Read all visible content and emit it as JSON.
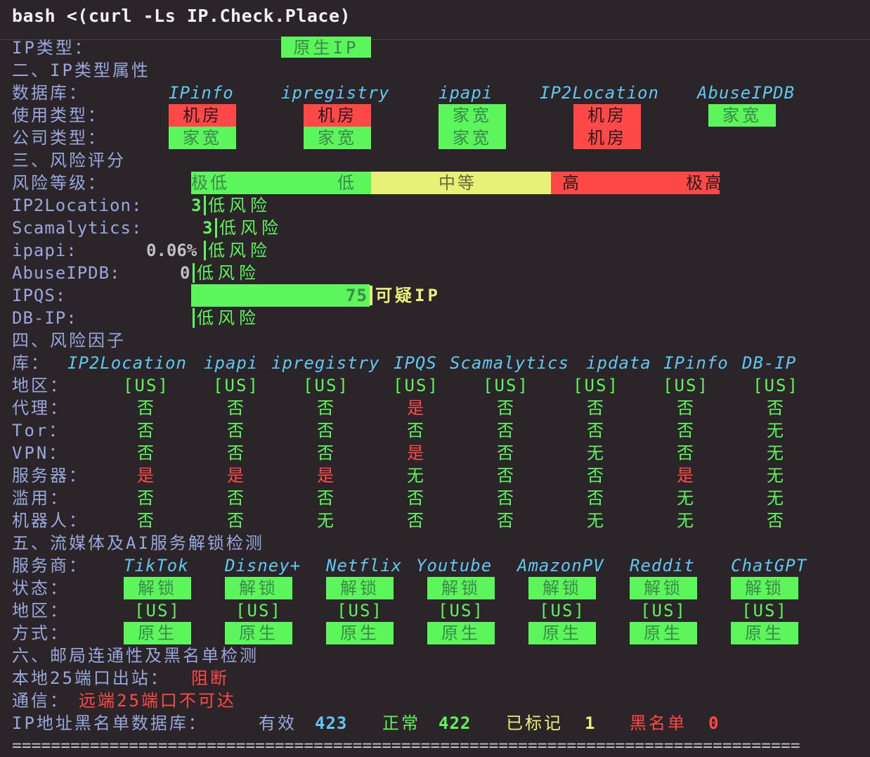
{
  "command": "bash <(curl -Ls IP.Check.Place)",
  "ip_type": {
    "label": "IP类型：",
    "value": "原生IP"
  },
  "section2": {
    "title": "二、IP类型属性",
    "db_label": "数据库：",
    "usage_label": "使用类型：",
    "company_label": "公司类型：",
    "sources": [
      "IPinfo",
      "ipregistry",
      "ipapi",
      "IP2Location",
      "AbuseIPDB"
    ],
    "usage": [
      "机房",
      "机房",
      "家宽",
      "机房",
      "家宽"
    ],
    "usage_colors": [
      "#ff4848",
      "#ff4848",
      "#5cf55c",
      "#ff4848",
      "#5cf55c"
    ],
    "company": [
      "家宽",
      "家宽",
      "家宽",
      "机房",
      ""
    ],
    "company_colors": [
      "#5cf55c",
      "#5cf55c",
      "#5cf55c",
      "#ff4848",
      ""
    ]
  },
  "section3": {
    "title": "三、风险评分",
    "level_label": "风险等级：",
    "scale": [
      "极低",
      "低",
      "中等",
      "高",
      "极高"
    ],
    "rows": [
      {
        "name": "IP2Location:",
        "score": "3",
        "result": "低风险"
      },
      {
        "name": "Scamalytics:",
        "score": "3",
        "result": "低风险"
      },
      {
        "name": "ipapi:",
        "score": "0.06%",
        "result": "低风险"
      },
      {
        "name": "AbuseIPDB:",
        "score": "0",
        "result": "低风险"
      },
      {
        "name": "IPQS:",
        "score": "75",
        "result": "可疑IP",
        "fill": 0.75
      },
      {
        "name": "DB-IP:",
        "score": "",
        "result": "低风险"
      }
    ]
  },
  "section4": {
    "title": "四、风险因子",
    "db_label": "库：",
    "sources": [
      "IP2Location",
      "ipapi",
      "ipregistry",
      "IPQS",
      "Scamalytics",
      "ipdata",
      "IPinfo",
      "DB-IP"
    ],
    "rows": [
      {
        "label": "地区：",
        "values": [
          "[US]",
          "[US]",
          "[US]",
          "[US]",
          "[US]",
          "[US]",
          "[US]",
          "[US]"
        ]
      },
      {
        "label": "代理：",
        "values": [
          "否",
          "否",
          "否",
          "是",
          "否",
          "否",
          "否",
          "否"
        ]
      },
      {
        "label": "Tor：",
        "values": [
          "否",
          "否",
          "否",
          "否",
          "否",
          "否",
          "否",
          "无"
        ]
      },
      {
        "label": "VPN：",
        "values": [
          "否",
          "否",
          "否",
          "是",
          "否",
          "无",
          "否",
          "无"
        ]
      },
      {
        "label": "服务器：",
        "values": [
          "是",
          "是",
          "是",
          "无",
          "否",
          "否",
          "是",
          "无"
        ]
      },
      {
        "label": "滥用：",
        "values": [
          "否",
          "否",
          "否",
          "否",
          "否",
          "否",
          "无",
          "无"
        ]
      },
      {
        "label": "机器人：",
        "values": [
          "否",
          "否",
          "无",
          "否",
          "否",
          "无",
          "无",
          "否"
        ]
      }
    ]
  },
  "section5": {
    "title": "五、流媒体及AI服务解锁检测",
    "provider_label": "服务商：",
    "status_label": "状态：",
    "region_label": "地区：",
    "method_label": "方式：",
    "providers": [
      "TikTok",
      "Disney+",
      "Netflix",
      "Youtube",
      "AmazonPV",
      "Reddit",
      "ChatGPT"
    ],
    "status": [
      "解锁",
      "解锁",
      "解锁",
      "解锁",
      "解锁",
      "解锁",
      "解锁"
    ],
    "region": [
      "[US]",
      "[US]",
      "[US]",
      "[US]",
      "[US]",
      "[US]",
      "[US]"
    ],
    "method": [
      "原生",
      "原生",
      "原生",
      "原生",
      "原生",
      "原生",
      "原生"
    ]
  },
  "section6": {
    "title": "六、邮局连通性及黑名单检测",
    "port25_label": "本地25端口出站：",
    "port25_value": "阻断",
    "comm_label": "通信：",
    "comm_value": "远端25端口不可达",
    "bl_label": "IP地址黑名单数据库：",
    "valid_label": "有效",
    "valid_value": "423",
    "normal_label": "正常",
    "normal_value": "422",
    "marked_label": "已标记",
    "marked_value": "1",
    "black_label": "黑名单",
    "black_value": "0"
  },
  "divider": "=================================================================================",
  "colors": {
    "green": "#5cf55c",
    "red": "#ff4848",
    "yellow": "#e8f077",
    "cyan": "#5ec8f0",
    "label": "#9aa7dc",
    "bg": "#2b2529"
  }
}
